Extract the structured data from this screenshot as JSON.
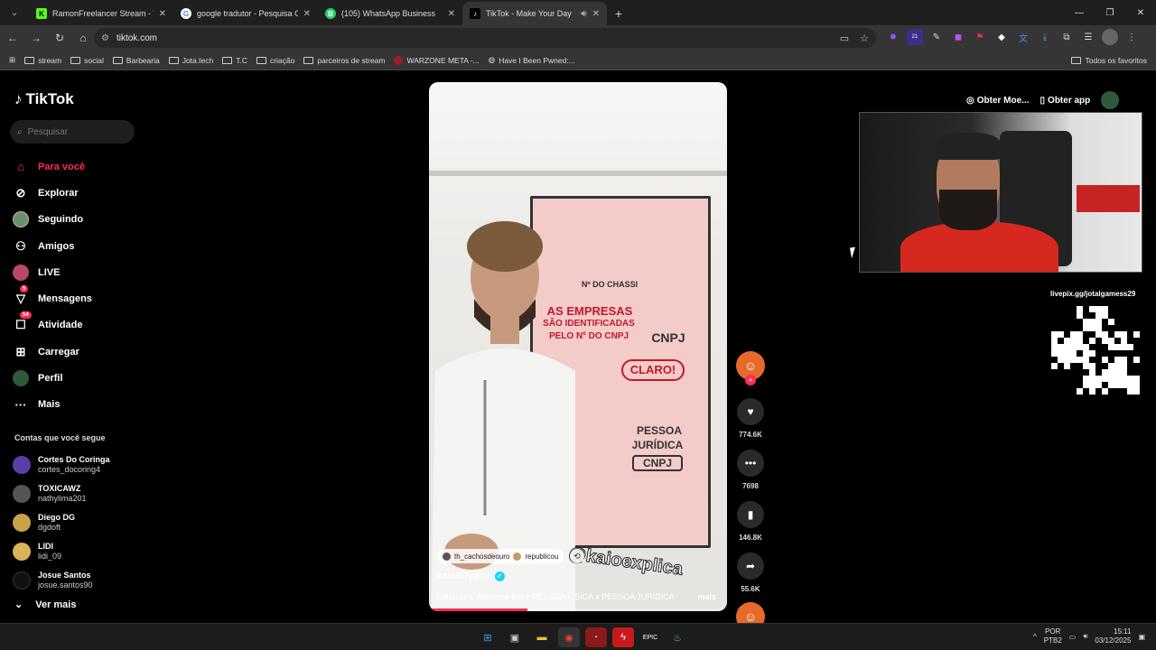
{
  "browser": {
    "tabs": [
      {
        "title": "RamonFreelancer Stream - Wat",
        "favicon": "kick-icon",
        "color": "#53fc18",
        "glyph": "K"
      },
      {
        "title": "google tradutor - Pesquisa Goo",
        "favicon": "google-icon",
        "color": "#ffffff",
        "glyph": "G"
      },
      {
        "title": "(105) WhatsApp Business",
        "favicon": "whatsapp-icon",
        "color": "#25d366",
        "glyph": "B"
      },
      {
        "title": "TikTok - Make Your Day",
        "favicon": "tiktok-icon",
        "color": "#000000",
        "glyph": "♪",
        "active": true
      }
    ],
    "url": "tiktok.com",
    "bookmarks": [
      "stream",
      "social",
      "Barbearia",
      "Jota.tech",
      "T.C",
      "criação",
      "parceiros de stream",
      "WARZONE META -...",
      "Have I Been Pwned:..."
    ],
    "bookmarks_right": "Todos os favoritos",
    "extension_badge": "21"
  },
  "tiktok": {
    "logo": "TikTok",
    "search_placeholder": "Pesquisar",
    "nav": [
      {
        "label": "Para você",
        "icon": "home-icon",
        "active": true
      },
      {
        "label": "Explorar",
        "icon": "compass-icon"
      },
      {
        "label": "Seguindo",
        "icon": "following-avatar-icon"
      },
      {
        "label": "Amigos",
        "icon": "friends-icon"
      },
      {
        "label": "LIVE",
        "icon": "live-avatar-icon"
      },
      {
        "label": "Mensagens",
        "icon": "messages-icon",
        "badge": "5"
      },
      {
        "label": "Atividade",
        "icon": "activity-icon",
        "badge": "54"
      },
      {
        "label": "Carregar",
        "icon": "upload-icon"
      },
      {
        "label": "Perfil",
        "icon": "profile-icon"
      },
      {
        "label": "Mais",
        "icon": "more-icon"
      }
    ],
    "following_title": "Contas que você segue",
    "following": [
      {
        "name": "Cortes Do Coringa",
        "username": "cortes_docoring4",
        "color": "#5b3fa8"
      },
      {
        "name": "TOXICAWZ",
        "username": "nathylima201",
        "color": "#444444"
      },
      {
        "name": "Diego DG",
        "username": "dgdoft",
        "color": "#c9a24a"
      },
      {
        "name": "LIDI",
        "username": "lidi_09",
        "color": "#d9b45a"
      },
      {
        "name": "Josue Santos",
        "username": "josue.santos90",
        "color": "#111111"
      }
    ],
    "see_more": "Ver mais",
    "top_right": {
      "coins": "Obter Moe...",
      "app": "Obter app"
    },
    "video": {
      "board": {
        "chassi": "Nº DO CHASSI",
        "line1": "AS EMPRESAS",
        "line2": "SÃO IDENTIFICADAS",
        "line3": "PELO Nº DO CNPJ",
        "cnpj_top": "CNPJ",
        "claro": "CLARO!",
        "pessoa": "PESSOA",
        "juridica": "JURÍDICA",
        "cnpj_bottom": "CNPJ"
      },
      "overlay_handle": "@kaioexplica",
      "repost_user": "th_cachosdeouro",
      "repost_label": "republicou",
      "author": "kaiooliveira",
      "caption": "Entenda a diferença entre PESSOA FÍSICA x PESSOA JURÍDICA",
      "caption_more": "mais",
      "progress": 0.33
    },
    "actions": {
      "likes": "774.6K",
      "comments": "7698",
      "saves": "146.8K",
      "shares": "55.6K"
    }
  },
  "stream_overlay": {
    "livepix": "livepix.gg/jotalgamess29"
  },
  "taskbar": {
    "lang_top": "POR",
    "lang_bottom": "PTB2",
    "time": "15:11",
    "date": "03/12/2025"
  }
}
